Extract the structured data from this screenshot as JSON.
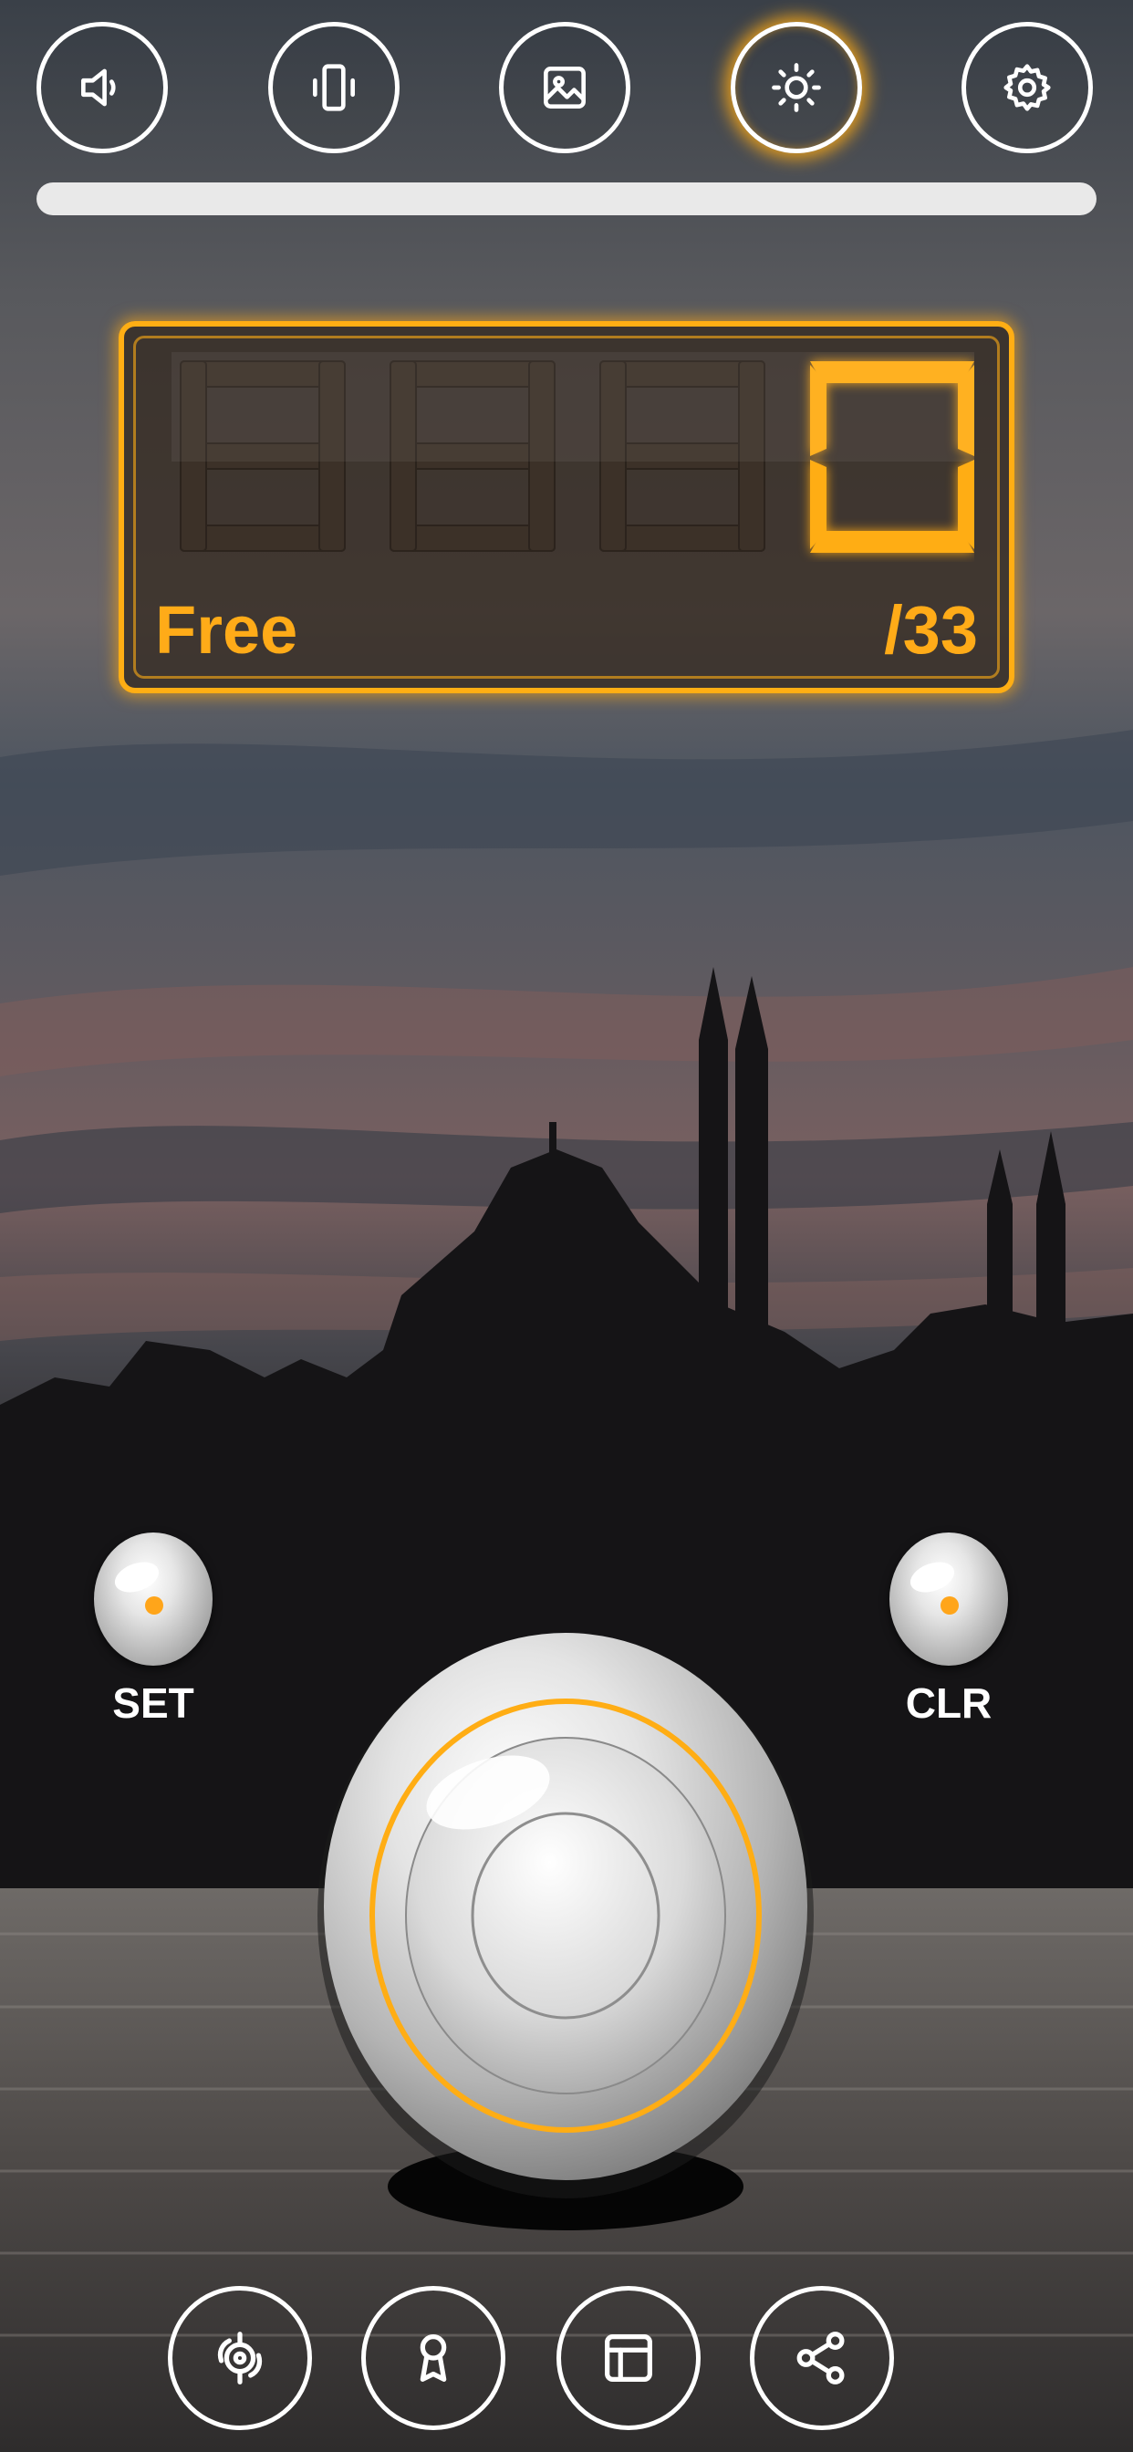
{
  "toolbar": {
    "icons": [
      "volume-icon",
      "vibration-icon",
      "image-icon",
      "brightness-icon",
      "settings-icon"
    ],
    "active_icon": "brightness-icon"
  },
  "progress": {
    "fraction": 0
  },
  "counter": {
    "display_value": "0",
    "mode_label": "Free",
    "target_label": "/33"
  },
  "controls": {
    "set_label": "SET",
    "clr_label": "CLR"
  },
  "bottom_bar": {
    "icons": [
      "tasbih-icon",
      "award-icon",
      "layout-icon",
      "share-icon"
    ]
  },
  "colors": {
    "accent": "#ffae14",
    "progress_track": "#e9e9e9",
    "icon_stroke": "#ffffff"
  }
}
